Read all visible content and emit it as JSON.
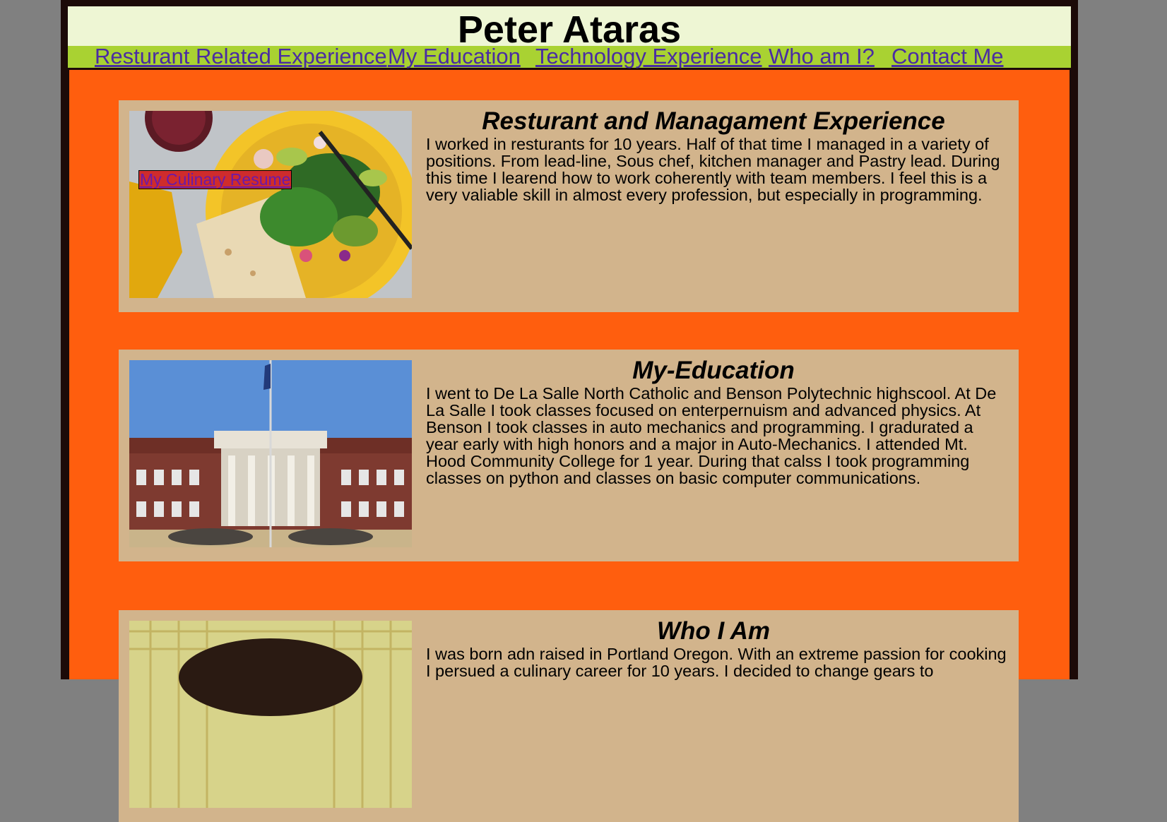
{
  "site": {
    "title": "Peter Ataras"
  },
  "nav": {
    "items": [
      "Resturant Related Experience",
      "My Education",
      "Technology Experience",
      "Who am I?",
      "Contact Me"
    ]
  },
  "sections": [
    {
      "heading": "Resturant and Managament Experience",
      "body": "I worked in resturants for 10 years. Half of that time I managed in a variety of positions. From lead-line, Sous chef, kitchen manager and Pastry lead. During this time I learend how to work coherently with team members. I feel this is a very valiable skill in almost every profession, but especially in programming.",
      "link_label": "My Culinary Resume"
    },
    {
      "heading": "My-Education",
      "body": "I went to De La Salle North Catholic and Benson Polytechnic highscool. At De La Salle I took classes focused on enterpernuism and advanced physics. At Benson I took classes in auto mechanics and programming. I gradurated a year early with high honors and a major in Auto-Mechanics. I attended Mt. Hood Community College for 1 year. During that calss I took programming classes on python and classes on basic computer communications."
    },
    {
      "heading": "Who I Am",
      "body": "I was born adn raised in Portland Oregon. With an extreme passion for cooking I persued a culinary career for 10 years. I decided to change gears to"
    }
  ],
  "colors": {
    "page_bg": "#808080",
    "frame": "#1c0a08",
    "header_bg": "#eef6d4",
    "nav_bg": "#a9d232",
    "main_bg": "#ff5e0e",
    "card_bg": "#d2b48c",
    "link": "#4a2ca3"
  }
}
